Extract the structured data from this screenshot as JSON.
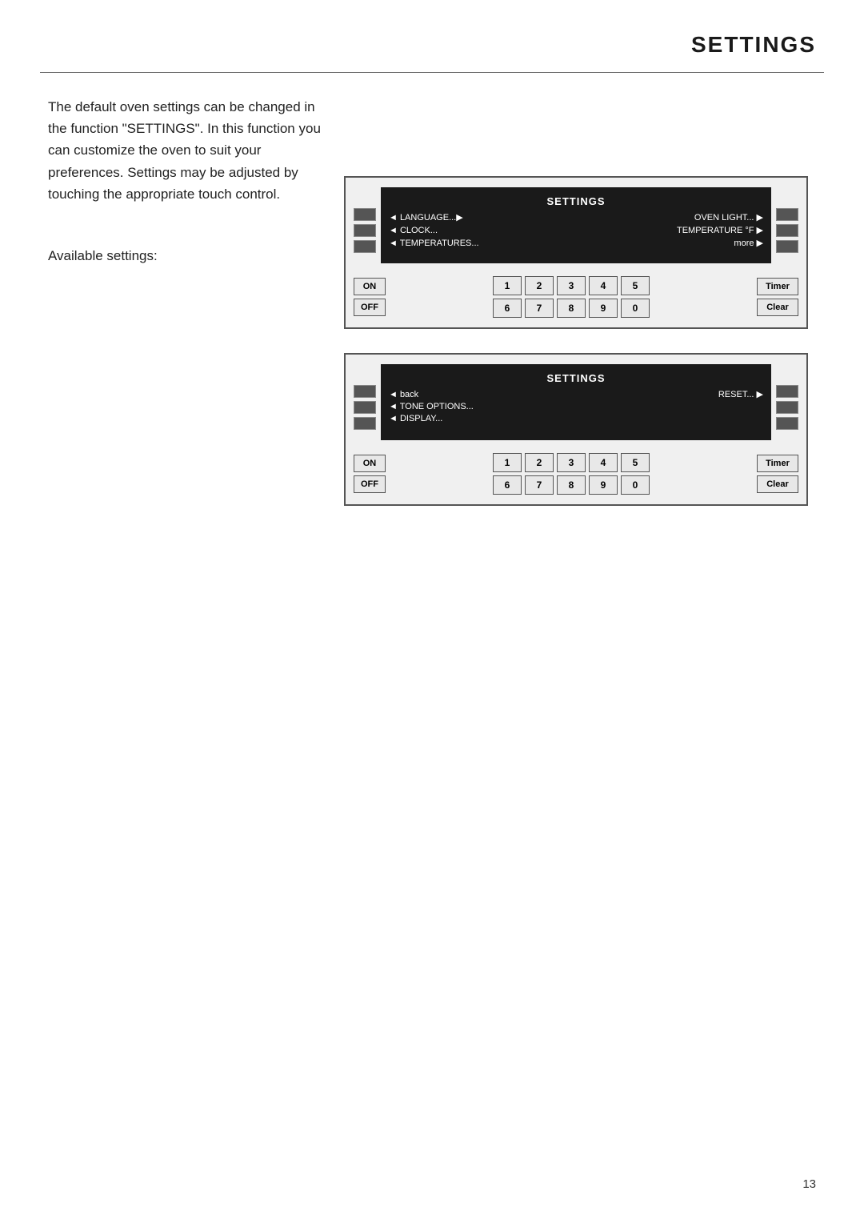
{
  "page": {
    "title": "SETTINGS",
    "page_number": "13",
    "body_text": "The default oven settings can be changed in the function \"SETTINGS\". In this function you can customize the oven to suit your preferences. Settings may be adjusted by touching the appropriate touch control.",
    "available_label": "Available settings:"
  },
  "panels": [
    {
      "id": "panel1",
      "screen_title": "SETTINGS",
      "rows": [
        {
          "left": "◄ LANGUAGE...▶",
          "right": "OVEN LIGHT... ▶"
        },
        {
          "left": "◄ CLOCK...",
          "right": "TEMPERATURE °F ▶"
        },
        {
          "left": "◄ TEMPERATURES...",
          "right": "more ▶"
        }
      ],
      "numpad_top": [
        "1",
        "2",
        "3",
        "4",
        "5"
      ],
      "numpad_bottom": [
        "6",
        "7",
        "8",
        "9",
        "0"
      ],
      "on_label": "ON",
      "off_label": "OFF",
      "timer_label": "Timer",
      "clear_label": "Clear"
    },
    {
      "id": "panel2",
      "screen_title": "SETTINGS",
      "rows": [
        {
          "left": "◄ back",
          "right": "RESET... ▶"
        },
        {
          "left": "◄ TONE OPTIONS...",
          "right": ""
        },
        {
          "left": "◄ DISPLAY...",
          "right": ""
        }
      ],
      "numpad_top": [
        "1",
        "2",
        "3",
        "4",
        "5"
      ],
      "numpad_bottom": [
        "6",
        "7",
        "8",
        "9",
        "0"
      ],
      "on_label": "ON",
      "off_label": "OFF",
      "timer_label": "Timer",
      "clear_label": "Clear"
    }
  ]
}
